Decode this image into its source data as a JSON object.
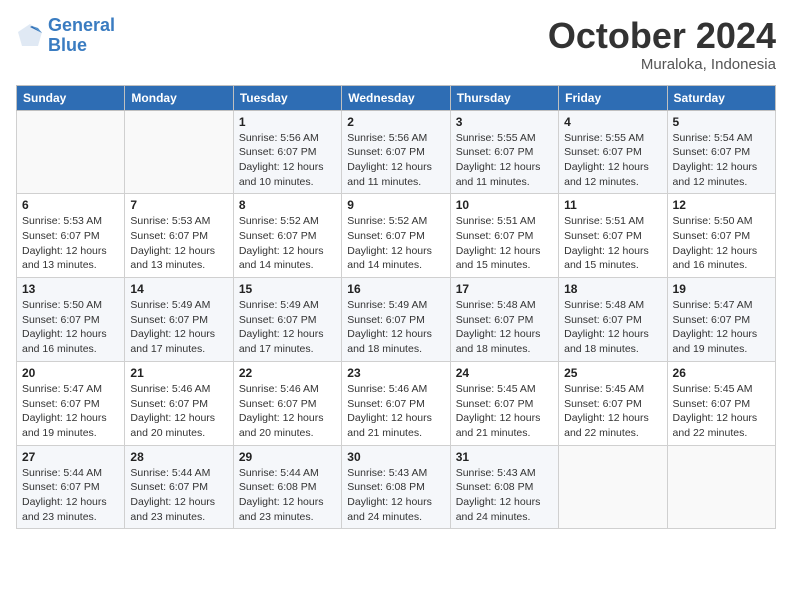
{
  "header": {
    "logo_line1": "General",
    "logo_line2": "Blue",
    "month": "October 2024",
    "location": "Muraloka, Indonesia"
  },
  "weekdays": [
    "Sunday",
    "Monday",
    "Tuesday",
    "Wednesday",
    "Thursday",
    "Friday",
    "Saturday"
  ],
  "weeks": [
    [
      {
        "day": "",
        "info": ""
      },
      {
        "day": "",
        "info": ""
      },
      {
        "day": "1",
        "info": "Sunrise: 5:56 AM\nSunset: 6:07 PM\nDaylight: 12 hours\nand 10 minutes."
      },
      {
        "day": "2",
        "info": "Sunrise: 5:56 AM\nSunset: 6:07 PM\nDaylight: 12 hours\nand 11 minutes."
      },
      {
        "day": "3",
        "info": "Sunrise: 5:55 AM\nSunset: 6:07 PM\nDaylight: 12 hours\nand 11 minutes."
      },
      {
        "day": "4",
        "info": "Sunrise: 5:55 AM\nSunset: 6:07 PM\nDaylight: 12 hours\nand 12 minutes."
      },
      {
        "day": "5",
        "info": "Sunrise: 5:54 AM\nSunset: 6:07 PM\nDaylight: 12 hours\nand 12 minutes."
      }
    ],
    [
      {
        "day": "6",
        "info": "Sunrise: 5:53 AM\nSunset: 6:07 PM\nDaylight: 12 hours\nand 13 minutes."
      },
      {
        "day": "7",
        "info": "Sunrise: 5:53 AM\nSunset: 6:07 PM\nDaylight: 12 hours\nand 13 minutes."
      },
      {
        "day": "8",
        "info": "Sunrise: 5:52 AM\nSunset: 6:07 PM\nDaylight: 12 hours\nand 14 minutes."
      },
      {
        "day": "9",
        "info": "Sunrise: 5:52 AM\nSunset: 6:07 PM\nDaylight: 12 hours\nand 14 minutes."
      },
      {
        "day": "10",
        "info": "Sunrise: 5:51 AM\nSunset: 6:07 PM\nDaylight: 12 hours\nand 15 minutes."
      },
      {
        "day": "11",
        "info": "Sunrise: 5:51 AM\nSunset: 6:07 PM\nDaylight: 12 hours\nand 15 minutes."
      },
      {
        "day": "12",
        "info": "Sunrise: 5:50 AM\nSunset: 6:07 PM\nDaylight: 12 hours\nand 16 minutes."
      }
    ],
    [
      {
        "day": "13",
        "info": "Sunrise: 5:50 AM\nSunset: 6:07 PM\nDaylight: 12 hours\nand 16 minutes."
      },
      {
        "day": "14",
        "info": "Sunrise: 5:49 AM\nSunset: 6:07 PM\nDaylight: 12 hours\nand 17 minutes."
      },
      {
        "day": "15",
        "info": "Sunrise: 5:49 AM\nSunset: 6:07 PM\nDaylight: 12 hours\nand 17 minutes."
      },
      {
        "day": "16",
        "info": "Sunrise: 5:49 AM\nSunset: 6:07 PM\nDaylight: 12 hours\nand 18 minutes."
      },
      {
        "day": "17",
        "info": "Sunrise: 5:48 AM\nSunset: 6:07 PM\nDaylight: 12 hours\nand 18 minutes."
      },
      {
        "day": "18",
        "info": "Sunrise: 5:48 AM\nSunset: 6:07 PM\nDaylight: 12 hours\nand 18 minutes."
      },
      {
        "day": "19",
        "info": "Sunrise: 5:47 AM\nSunset: 6:07 PM\nDaylight: 12 hours\nand 19 minutes."
      }
    ],
    [
      {
        "day": "20",
        "info": "Sunrise: 5:47 AM\nSunset: 6:07 PM\nDaylight: 12 hours\nand 19 minutes."
      },
      {
        "day": "21",
        "info": "Sunrise: 5:46 AM\nSunset: 6:07 PM\nDaylight: 12 hours\nand 20 minutes."
      },
      {
        "day": "22",
        "info": "Sunrise: 5:46 AM\nSunset: 6:07 PM\nDaylight: 12 hours\nand 20 minutes."
      },
      {
        "day": "23",
        "info": "Sunrise: 5:46 AM\nSunset: 6:07 PM\nDaylight: 12 hours\nand 21 minutes."
      },
      {
        "day": "24",
        "info": "Sunrise: 5:45 AM\nSunset: 6:07 PM\nDaylight: 12 hours\nand 21 minutes."
      },
      {
        "day": "25",
        "info": "Sunrise: 5:45 AM\nSunset: 6:07 PM\nDaylight: 12 hours\nand 22 minutes."
      },
      {
        "day": "26",
        "info": "Sunrise: 5:45 AM\nSunset: 6:07 PM\nDaylight: 12 hours\nand 22 minutes."
      }
    ],
    [
      {
        "day": "27",
        "info": "Sunrise: 5:44 AM\nSunset: 6:07 PM\nDaylight: 12 hours\nand 23 minutes."
      },
      {
        "day": "28",
        "info": "Sunrise: 5:44 AM\nSunset: 6:07 PM\nDaylight: 12 hours\nand 23 minutes."
      },
      {
        "day": "29",
        "info": "Sunrise: 5:44 AM\nSunset: 6:08 PM\nDaylight: 12 hours\nand 23 minutes."
      },
      {
        "day": "30",
        "info": "Sunrise: 5:43 AM\nSunset: 6:08 PM\nDaylight: 12 hours\nand 24 minutes."
      },
      {
        "day": "31",
        "info": "Sunrise: 5:43 AM\nSunset: 6:08 PM\nDaylight: 12 hours\nand 24 minutes."
      },
      {
        "day": "",
        "info": ""
      },
      {
        "day": "",
        "info": ""
      }
    ]
  ]
}
